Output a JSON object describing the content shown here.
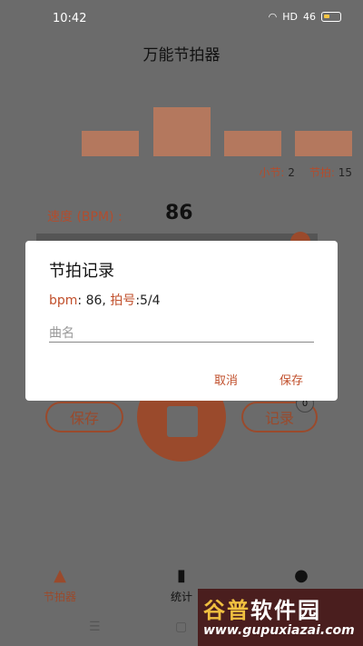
{
  "status": {
    "time": "10:42",
    "hd_label": "HD",
    "signal_label": "46"
  },
  "app": {
    "title": "万能节拍器"
  },
  "beats": {
    "measure_label": "小节:",
    "measure_value": "2",
    "beat_label": "节拍:",
    "beat_value": "15"
  },
  "tempo": {
    "label": "速度 (BPM) :",
    "value": "86"
  },
  "controls": {
    "save_label": "保存",
    "record_label": "记录",
    "record_badge": "0"
  },
  "dialog": {
    "title": "节拍记录",
    "bpm_label": "bpm",
    "bpm_value": ": 86, ",
    "meter_label": "拍号",
    "meter_value": ":5/4",
    "song_name_placeholder": "曲名",
    "cancel_label": "取消",
    "save_label": "保存"
  },
  "nav": {
    "items": [
      {
        "label": "节拍器",
        "icon": "metronome-icon"
      },
      {
        "label": "统计",
        "icon": "bar-chart-icon"
      },
      {
        "label": "",
        "icon": "user-icon"
      }
    ]
  },
  "watermark": {
    "title_part1": "谷普",
    "title_part2": "软件园",
    "url": "www.gupuxiazai.com"
  },
  "colors": {
    "accent": "#c1502c",
    "overlay": "#6b6b6b"
  }
}
